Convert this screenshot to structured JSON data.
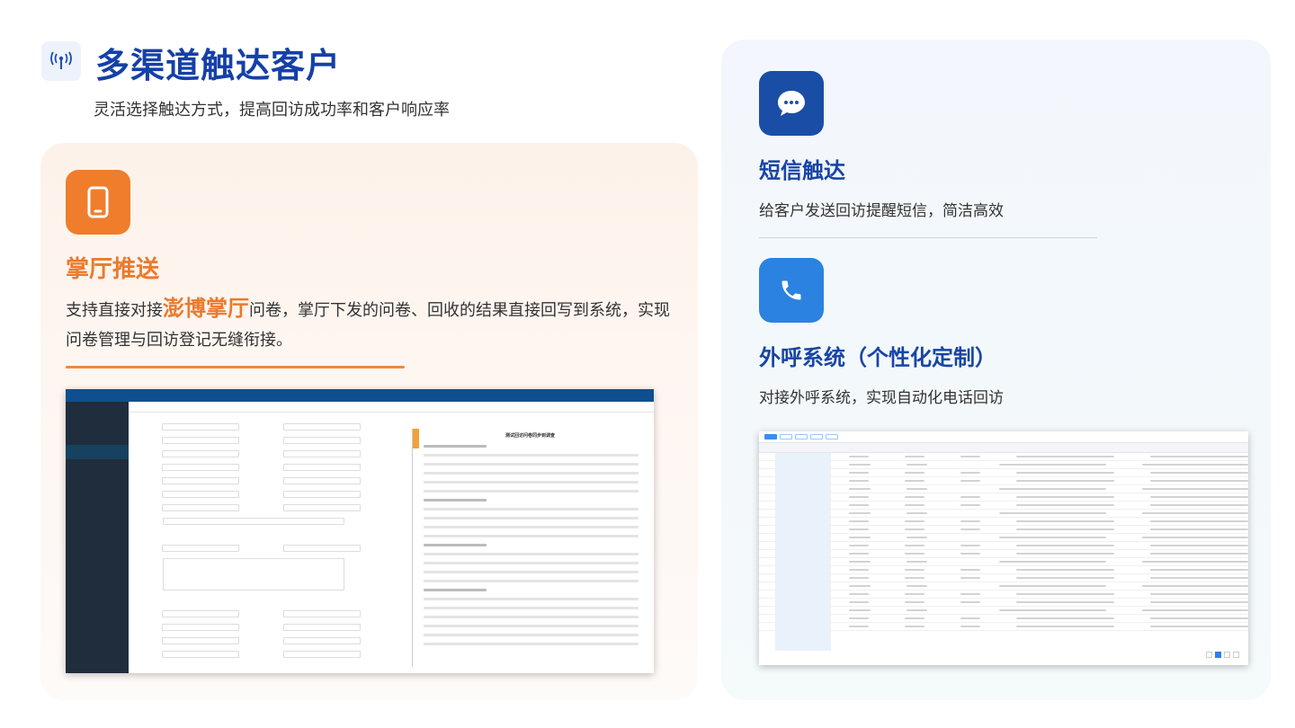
{
  "header": {
    "title": "多渠道触达客户",
    "subtitle": "灵活选择触达方式，提高回访成功率和客户响应率",
    "icon": "antenna-signal-icon"
  },
  "left_card": {
    "icon": "mobile-phone-icon",
    "title": "掌厅推送",
    "desc_before": "支持直接对接",
    "desc_highlight": "澎博掌厅",
    "desc_after": "问卷，掌厅下发的问卷、回收的结果直接回写到系统，实现问卷管理与回访登记无缝衔接。",
    "screenshot": {
      "panel_title": "测试回访问卷同步到调查"
    }
  },
  "right_card": {
    "sms": {
      "icon": "chat-bubble-icon",
      "title": "短信触达",
      "desc": "给客户发送回访提醒短信，简洁高效"
    },
    "call": {
      "icon": "phone-handset-icon",
      "title": "外呼系统（个性化定制）",
      "desc": "对接外呼系统，实现自动化电话回访"
    }
  },
  "colors": {
    "title_blue": "#1540a8",
    "accent_orange": "#ea7a2c",
    "icon_blue_dark": "#1a4ea6",
    "icon_blue_light": "#2b82e0"
  }
}
